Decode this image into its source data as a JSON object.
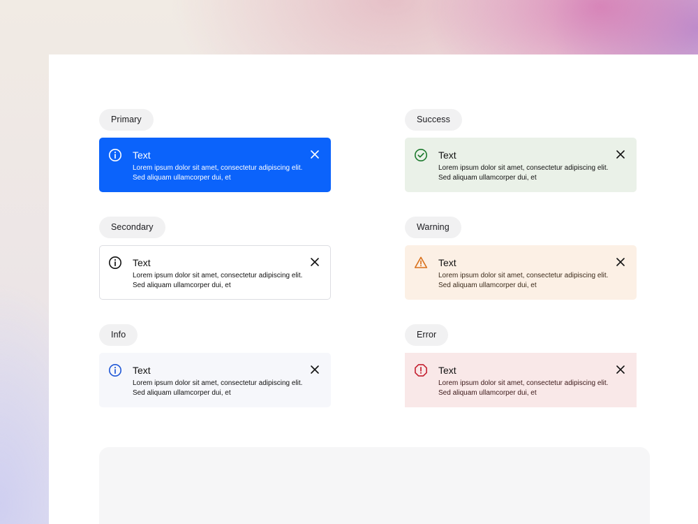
{
  "colors": {
    "primary": "#0b63fb",
    "success_icon": "#1e7a2e",
    "warning_icon": "#d9711c",
    "error_icon": "#c41f2f",
    "info_icon": "#1f57d6"
  },
  "alerts": {
    "primary": {
      "chip": "Primary",
      "title": "Text",
      "description": "Lorem ipsum dolor sit amet, consectetur adipiscing elit. Sed aliquam ullamcorper dui, et",
      "icon": "info-icon"
    },
    "secondary": {
      "chip": "Secondary",
      "title": "Text",
      "description": "Lorem ipsum dolor sit amet, consectetur adipiscing elit. Sed aliquam ullamcorper dui, et",
      "icon": "info-icon"
    },
    "info": {
      "chip": "Info",
      "title": "Text",
      "description": "Lorem ipsum dolor sit amet, consectetur adipiscing elit. Sed aliquam ullamcorper dui, et",
      "icon": "info-icon"
    },
    "success": {
      "chip": "Success",
      "title": "Text",
      "description": "Lorem ipsum dolor sit amet, consectetur adipiscing elit. Sed aliquam ullamcorper dui, et",
      "icon": "check-circle-icon"
    },
    "warning": {
      "chip": "Warning",
      "title": "Text",
      "description": "Lorem ipsum dolor sit amet, consectetur adipiscing elit. Sed aliquam ullamcorper dui, et",
      "icon": "warning-triangle-icon"
    },
    "error": {
      "chip": "Error",
      "title": "Text",
      "description": "Lorem ipsum dolor sit amet, consectetur adipiscing elit. Sed aliquam ullamcorper dui, et",
      "icon": "error-octagon-icon"
    }
  }
}
